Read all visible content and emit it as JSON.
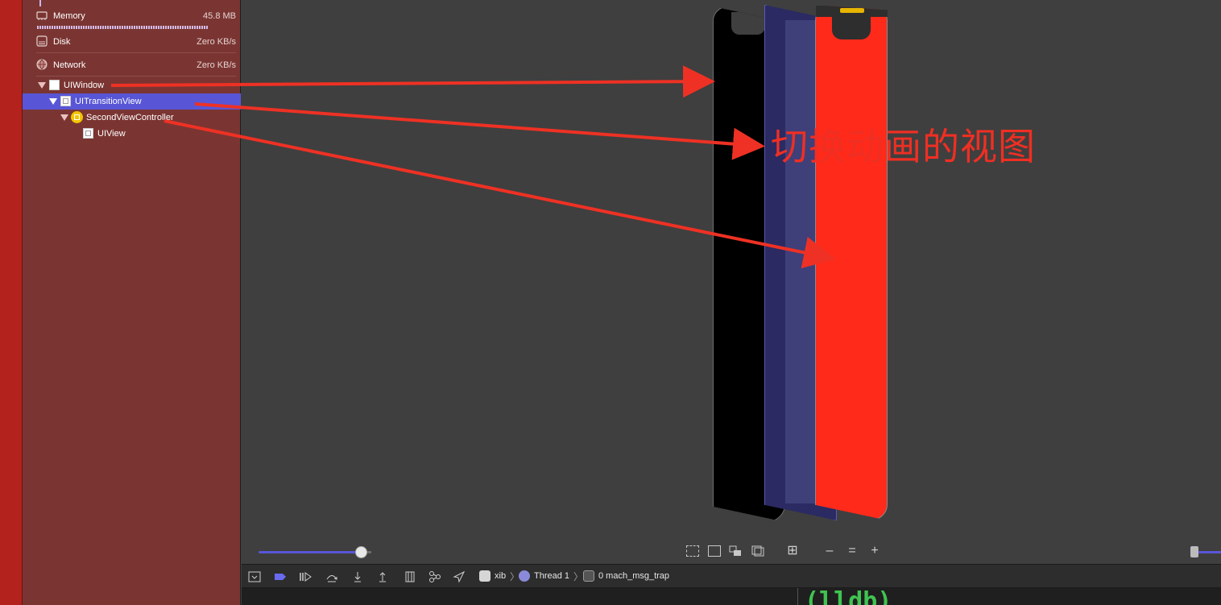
{
  "gauges": {
    "memory": {
      "label": "Memory",
      "value": "45.8 MB"
    },
    "disk": {
      "label": "Disk",
      "value": "Zero KB/s"
    },
    "network": {
      "label": "Network",
      "value": "Zero KB/s"
    }
  },
  "hierarchy": [
    {
      "label": "UIWindow"
    },
    {
      "label": "UITransitionView"
    },
    {
      "label": "SecondViewController"
    },
    {
      "label": "UIView"
    }
  ],
  "annotation": "切换动画的视图",
  "debug_bar": {
    "breadcrumb": [
      "xib",
      "Thread 1",
      "0 mach_msg_trap"
    ]
  },
  "console": {
    "prompt": "(lldb)"
  },
  "colors": {
    "selection": "#5856d6",
    "annotation_red": "#ef2f23",
    "navigator_bg": "#7a3532",
    "lldb_green": "#40c451"
  }
}
